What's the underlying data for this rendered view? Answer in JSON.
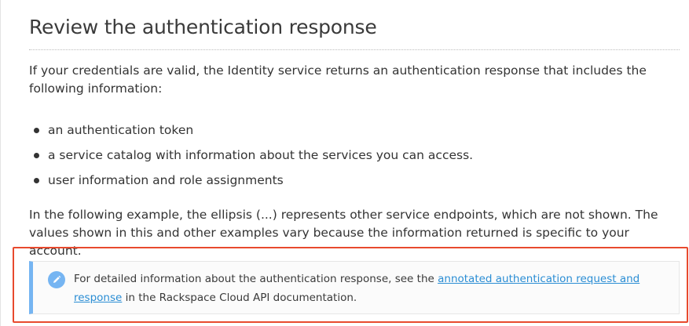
{
  "section": {
    "heading": "Review the authentication response",
    "intro": "If your credentials are valid, the Identity service returns an authentication response that includes the following information:",
    "bullets": [
      "an authentication token",
      "a service catalog with information about the services you can access.",
      "user information and role assignments"
    ],
    "example_text": "In the following example, the ellipsis (...) represents other service endpoints, which are not shown. The values shown in this and other examples vary because the information returned is specific to your account."
  },
  "note": {
    "icon": "pencil-icon",
    "text_before": "For detailed information about the authentication response, see the ",
    "link_text": "annotated authentication request and response",
    "text_after": " in the Rackspace Cloud API documentation."
  },
  "colors": {
    "highlight_border": "#e84a2e",
    "note_accent": "#76b5f2",
    "link": "#2a8dd4"
  }
}
